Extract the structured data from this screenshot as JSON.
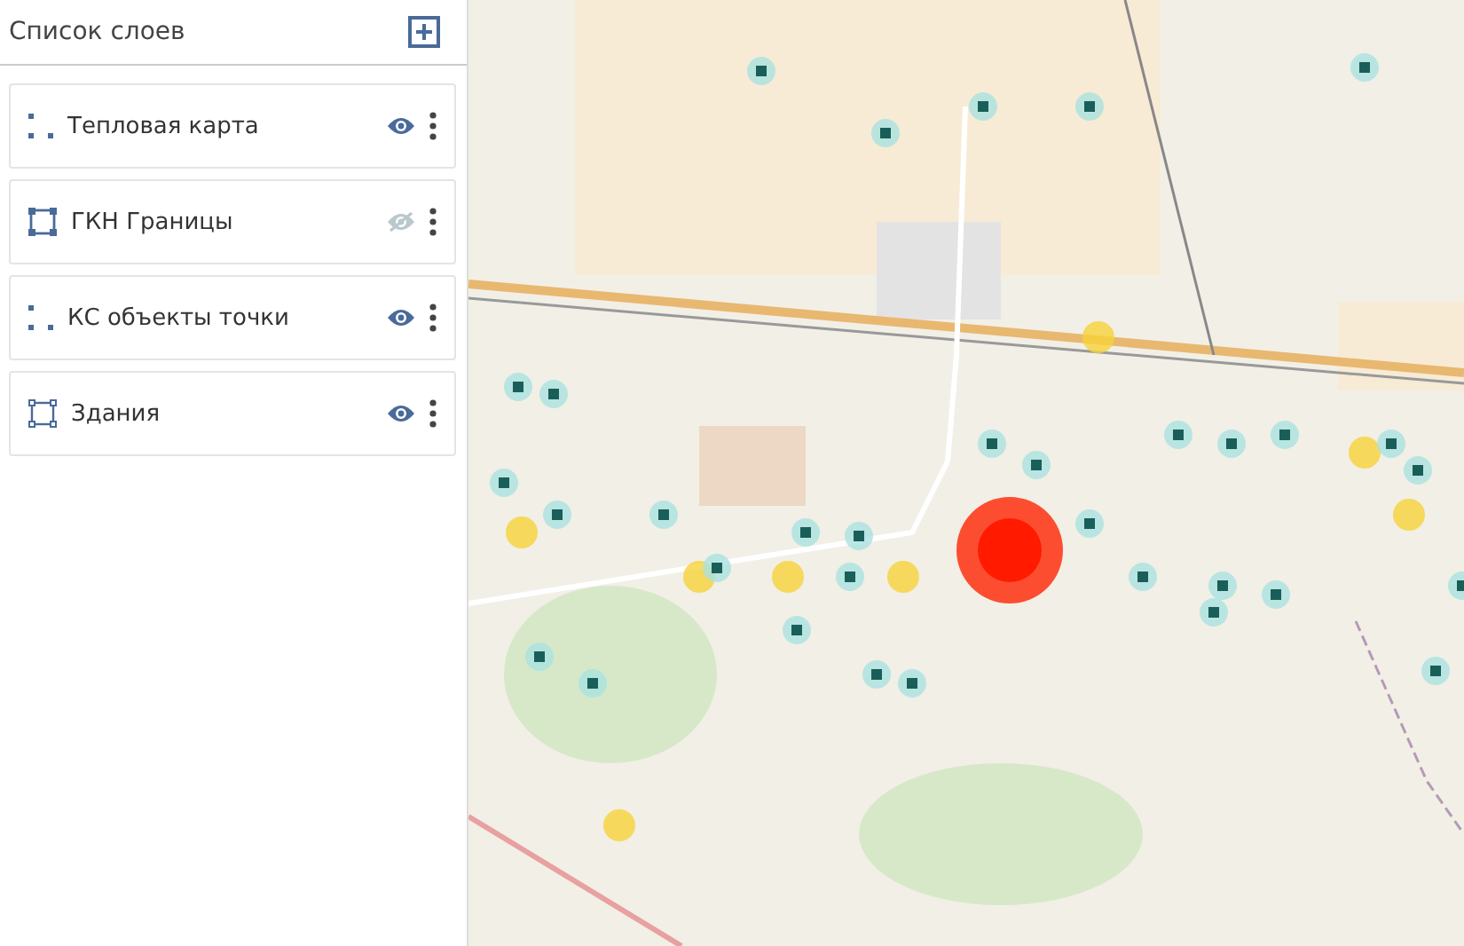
{
  "sidebar": {
    "title": "Список слоев",
    "layers": [
      {
        "name": "Тепловая карта",
        "kind": "points",
        "visible": true
      },
      {
        "name": "ГКН Границы",
        "kind": "area",
        "visible": false
      },
      {
        "name": "КС объекты точки",
        "kind": "points",
        "visible": true
      },
      {
        "name": "Здания",
        "kind": "outline",
        "visible": true
      }
    ]
  }
}
